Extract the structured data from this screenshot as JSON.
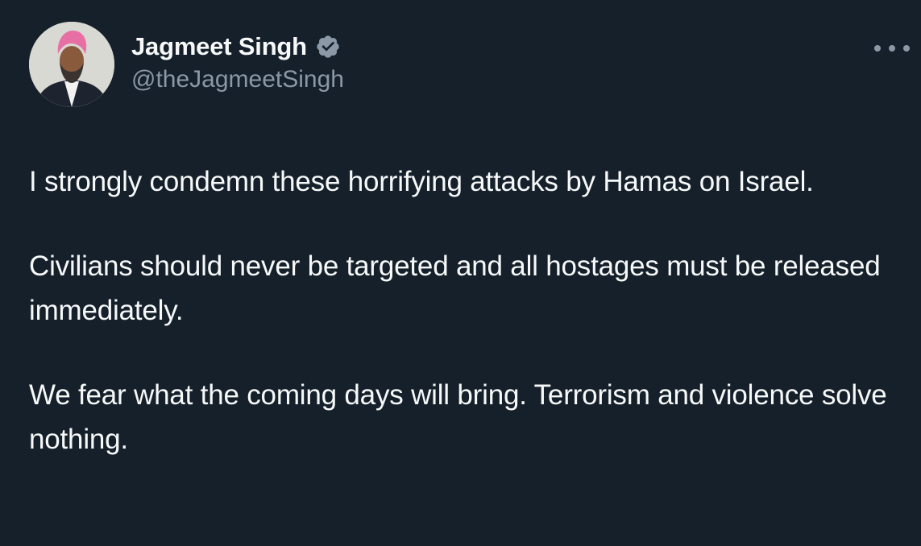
{
  "tweet": {
    "author": {
      "display_name": "Jagmeet Singh",
      "handle": "@theJagmeetSingh",
      "verified": true,
      "avatar_icon": "profile-photo"
    },
    "more_icon": "ellipsis-icon",
    "paragraphs": [
      "I strongly condemn these horrifying attacks by Hamas on Israel.",
      "Civilians should never be targeted and all hostages must be released immediately.",
      "We fear what the coming days will bring. Terrorism and violence solve nothing."
    ]
  },
  "colors": {
    "background": "#15202b",
    "text_primary": "#f7f9f9",
    "text_secondary": "#8b98a5",
    "verified_badge": "#8b98a5"
  }
}
